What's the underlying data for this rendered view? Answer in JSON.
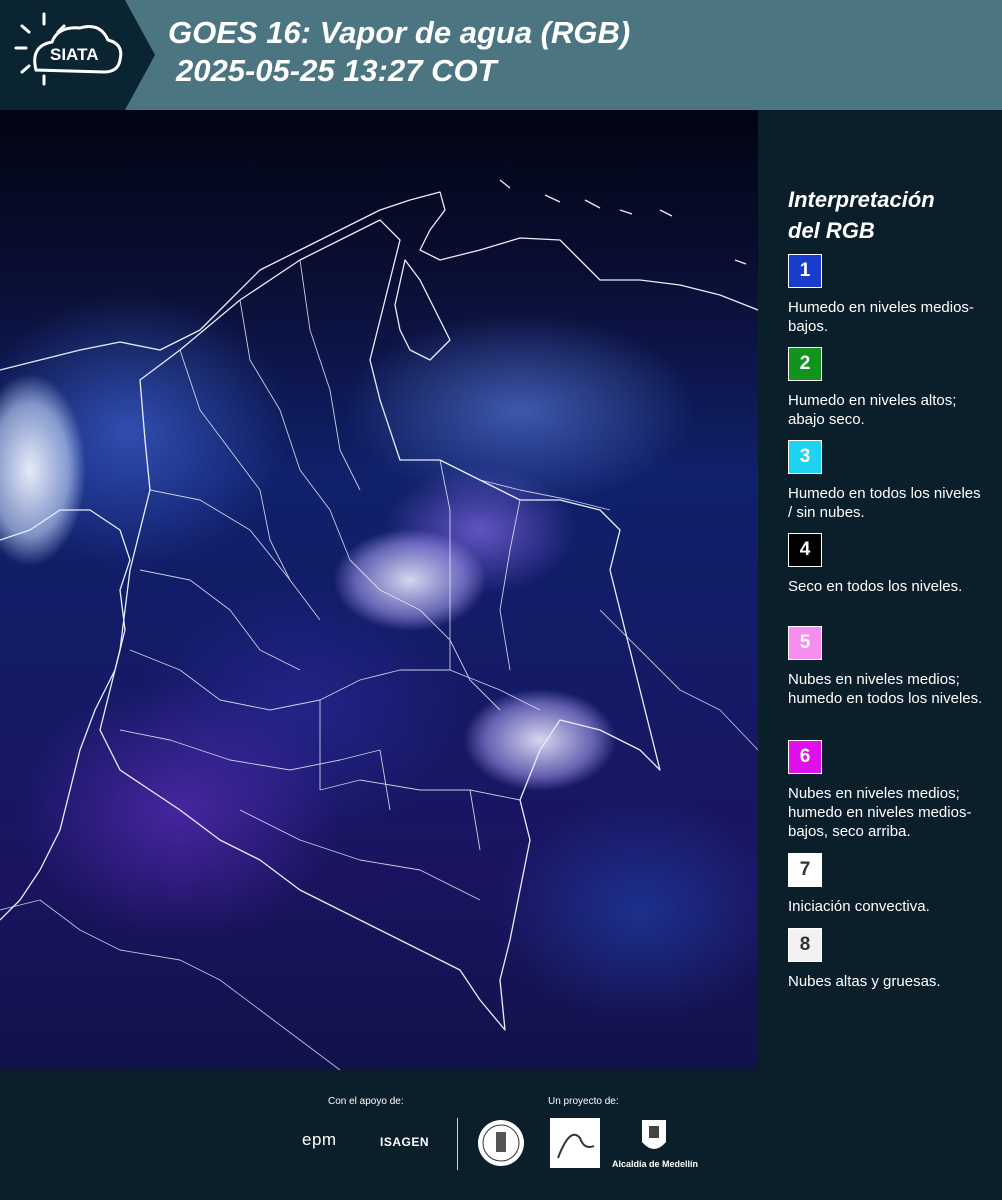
{
  "header": {
    "logo_text": "SIATA",
    "title_line1": "GOES 16: Vapor de agua (RGB)",
    "title_line2": "2025-05-25 13:27 COT"
  },
  "legend": {
    "title_line1": "Interpretación",
    "title_line2": "del RGB",
    "items": [
      {
        "number": "1",
        "color": "#1a3ccc",
        "text_color": "#ffffff",
        "text": "Humedo en niveles medios-bajos."
      },
      {
        "number": "2",
        "color": "#12931d",
        "text_color": "#ffffff",
        "text": "Humedo en niveles altos; abajo seco."
      },
      {
        "number": "3",
        "color": "#1ed3f0",
        "text_color": "#ffffff",
        "text": "Humedo en todos los niveles / sin nubes."
      },
      {
        "number": "4",
        "color": "#000000",
        "text_color": "#ffffff",
        "text": "Seco en todos los niveles."
      },
      {
        "number": "5",
        "color": "#f58ef0",
        "text_color": "#ffffff",
        "text": "Nubes en niveles medios; humedo en todos los niveles."
      },
      {
        "number": "6",
        "color": "#e010ec",
        "text_color": "#ffffff",
        "text": "Nubes en niveles medios; humedo en niveles medios-bajos, seco arriba."
      },
      {
        "number": "7",
        "color": "#ffffff",
        "text_color": "#333333",
        "text": "Iniciación convectiva."
      },
      {
        "number": "8",
        "color": "#f2f2f2",
        "text_color": "#333333",
        "text": "Nubes altas y gruesas."
      }
    ]
  },
  "footer": {
    "support_label": "Con el apoyo de:",
    "project_label": "Un proyecto de:",
    "epm": "epm",
    "isagen": "ISAGEN",
    "alcaldia": "Alcaldía de Medellín"
  }
}
